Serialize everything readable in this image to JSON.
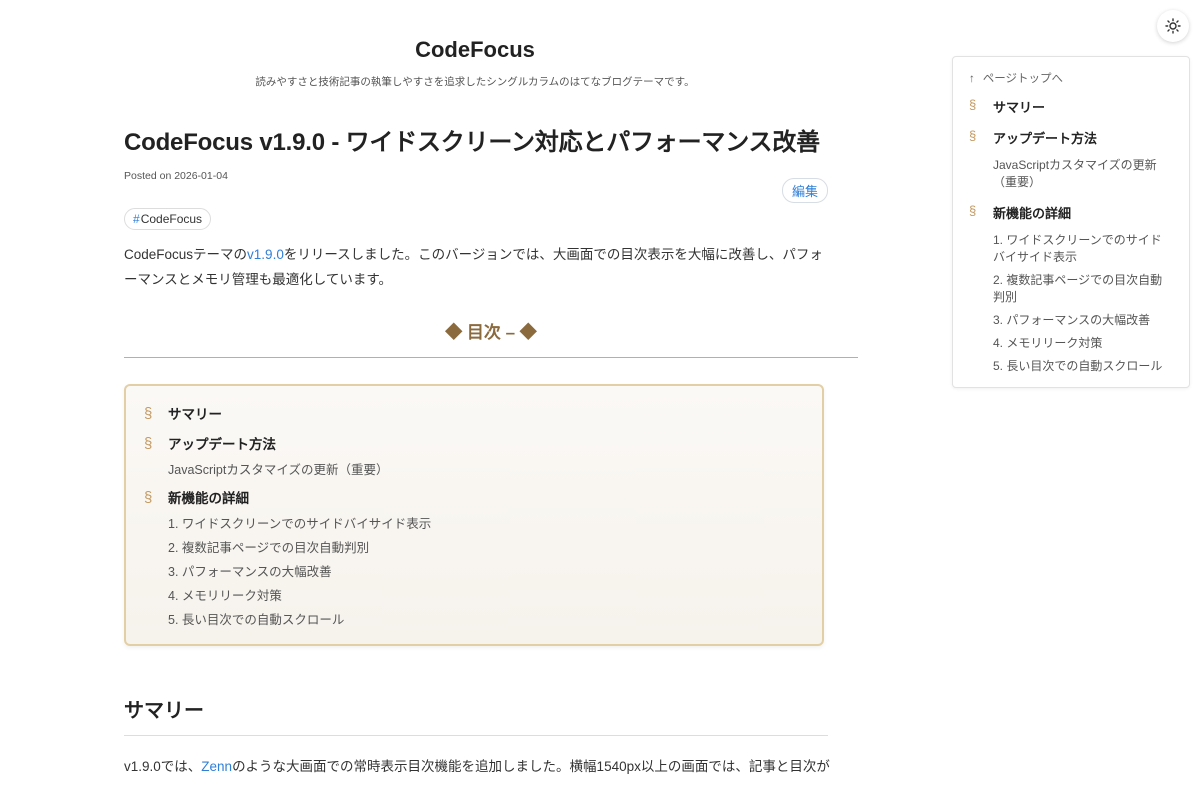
{
  "theme_toggle": {
    "icon": "sun-icon"
  },
  "site": {
    "title": "CodeFocus",
    "description": "読みやすさと技術記事の執筆しやすさを追求したシングルカラムのはてなブログテーマです。"
  },
  "article": {
    "title": "CodeFocus v1.9.0 - ワイドスクリーン対応とパフォーマンス改善",
    "posted": "Posted on 2026-01-04",
    "edit_label": "編集",
    "tag_hash": "#",
    "tag": "CodeFocus",
    "intro_before": "CodeFocusテーマの",
    "intro_link": "v1.9.0",
    "intro_after": "をリリースしました。このバージョンでは、大画面での目次表示を大幅に改善し、パフォーマンスとメモリ管理も最適化しています。"
  },
  "toc": {
    "heading": "◆ 目次 – ◆",
    "symbol": "§",
    "items": [
      {
        "label": "サマリー",
        "children": []
      },
      {
        "label": "アップデート方法",
        "children": [
          "JavaScriptカスタマイズの更新（重要）"
        ]
      },
      {
        "label": "新機能の詳細",
        "children": [
          "1. ワイドスクリーンでのサイドバイサイド表示",
          "2. 複数記事ページでの目次自動判別",
          "3. パフォーマンスの大幅改善",
          "4. メモリリーク対策",
          "5. 長い目次での自動スクロール"
        ]
      }
    ]
  },
  "section1": {
    "title": "サマリー",
    "text_before": "v1.9.0では、",
    "link": "Zenn",
    "text_after": "のような大画面での常時表示目次機能を追加しました。横幅1540px以上の画面では、記事と目次が"
  },
  "side_toc": {
    "back_arrow": "↑",
    "back_label": "ページトップへ",
    "symbol": "§",
    "items": [
      {
        "label": "サマリー",
        "children": []
      },
      {
        "label": "アップデート方法",
        "children": [
          "JavaScriptカスタマイズの更新（重要）"
        ]
      },
      {
        "label": "新機能の詳細",
        "children": [
          "1. ワイドスクリーンでのサイドバイサイド表示",
          "2. 複数記事ページでの目次自動判別",
          "3. パフォーマンスの大幅改善",
          "4. メモリリーク対策",
          "5. 長い目次での自動スクロール"
        ]
      }
    ]
  }
}
